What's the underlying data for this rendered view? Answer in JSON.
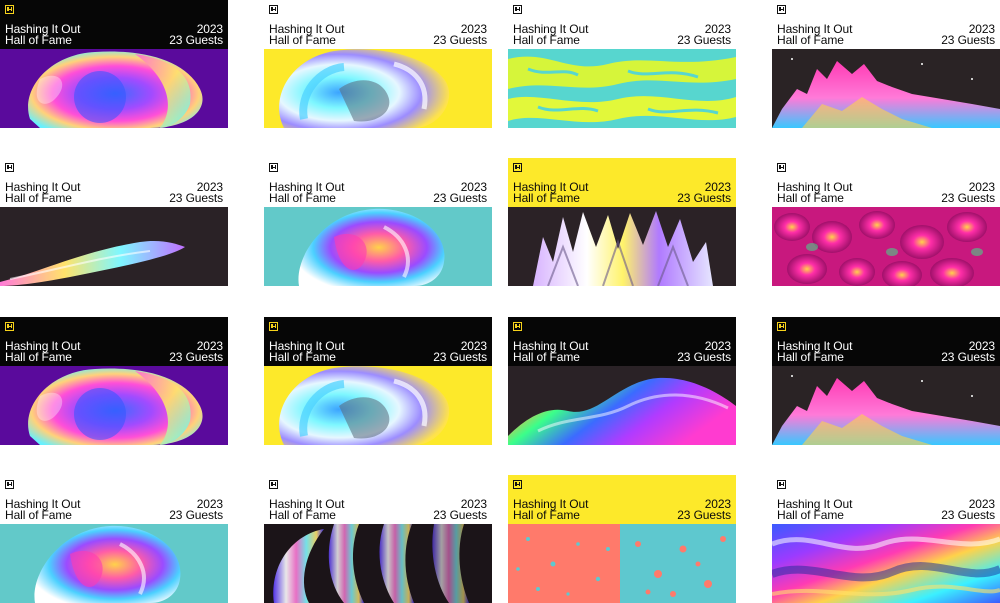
{
  "page": {
    "background": "#ffffff"
  },
  "cards": [
    {
      "title": "Hashing It Out",
      "subtitle": "Hall of Fame",
      "year": "2023",
      "guests": "23 Guests",
      "header": "dark",
      "art": "purple-bloom",
      "logo_icon": "hashing-logo-icon"
    },
    {
      "title": "Hashing It Out",
      "subtitle": "Hall of Fame",
      "year": "2023",
      "guests": "23 Guests",
      "header": "light",
      "art": "yellow-chrome",
      "logo_icon": "hashing-logo-icon"
    },
    {
      "title": "Hashing It Out",
      "subtitle": "Hall of Fame",
      "year": "2023",
      "guests": "23 Guests",
      "header": "light",
      "art": "lime-swirl",
      "logo_icon": "hashing-logo-icon"
    },
    {
      "title": "Hashing It Out",
      "subtitle": "Hall of Fame",
      "year": "2023",
      "guests": "23 Guests",
      "header": "light",
      "art": "pink-mountains",
      "logo_icon": "hashing-logo-icon"
    },
    {
      "title": "Hashing It Out",
      "subtitle": "Hall of Fame",
      "year": "2023",
      "guests": "23 Guests",
      "header": "light",
      "art": "dark-wave",
      "logo_icon": "hashing-logo-icon"
    },
    {
      "title": "Hashing It Out",
      "subtitle": "Hall of Fame",
      "year": "2023",
      "guests": "23 Guests",
      "header": "light",
      "art": "teal-bloom",
      "logo_icon": "hashing-logo-icon"
    },
    {
      "title": "Hashing It Out",
      "subtitle": "Hall of Fame",
      "year": "2023",
      "guests": "23 Guests",
      "header": "yellow",
      "art": "crystal-spikes",
      "logo_icon": "hashing-logo-icon"
    },
    {
      "title": "Hashing It Out",
      "subtitle": "Hall of Fame",
      "year": "2023",
      "guests": "23 Guests",
      "header": "light",
      "art": "magenta-bumps",
      "logo_icon": "hashing-logo-icon"
    },
    {
      "title": "Hashing It Out",
      "subtitle": "Hall of Fame",
      "year": "2023",
      "guests": "23 Guests",
      "header": "dark",
      "art": "purple-bloom",
      "logo_icon": "hashing-logo-icon"
    },
    {
      "title": "Hashing It Out",
      "subtitle": "Hall of Fame",
      "year": "2023",
      "guests": "23 Guests",
      "header": "dark",
      "art": "yellow-chrome",
      "logo_icon": "hashing-logo-icon"
    },
    {
      "title": "Hashing It Out",
      "subtitle": "Hall of Fame",
      "year": "2023",
      "guests": "23 Guests",
      "header": "dark",
      "art": "rainbow-blob",
      "logo_icon": "hashing-logo-icon"
    },
    {
      "title": "Hashing It Out",
      "subtitle": "Hall of Fame",
      "year": "2023",
      "guests": "23 Guests",
      "header": "dark",
      "art": "pink-mountains",
      "logo_icon": "hashing-logo-icon"
    },
    {
      "title": "Hashing It Out",
      "subtitle": "Hall of Fame",
      "year": "2023",
      "guests": "23 Guests",
      "header": "light",
      "art": "teal-bloom",
      "logo_icon": "hashing-logo-icon"
    },
    {
      "title": "Hashing It Out",
      "subtitle": "Hall of Fame",
      "year": "2023",
      "guests": "23 Guests",
      "header": "light",
      "art": "glass-stripes",
      "logo_icon": "hashing-logo-icon"
    },
    {
      "title": "Hashing It Out",
      "subtitle": "Hall of Fame",
      "year": "2023",
      "guests": "23 Guests",
      "header": "yellow",
      "art": "coral-speckle",
      "logo_icon": "hashing-logo-icon"
    },
    {
      "title": "Hashing It Out",
      "subtitle": "Hall of Fame",
      "year": "2023",
      "guests": "23 Guests",
      "header": "light",
      "art": "liquid-rainbow",
      "logo_icon": "hashing-logo-icon"
    }
  ]
}
